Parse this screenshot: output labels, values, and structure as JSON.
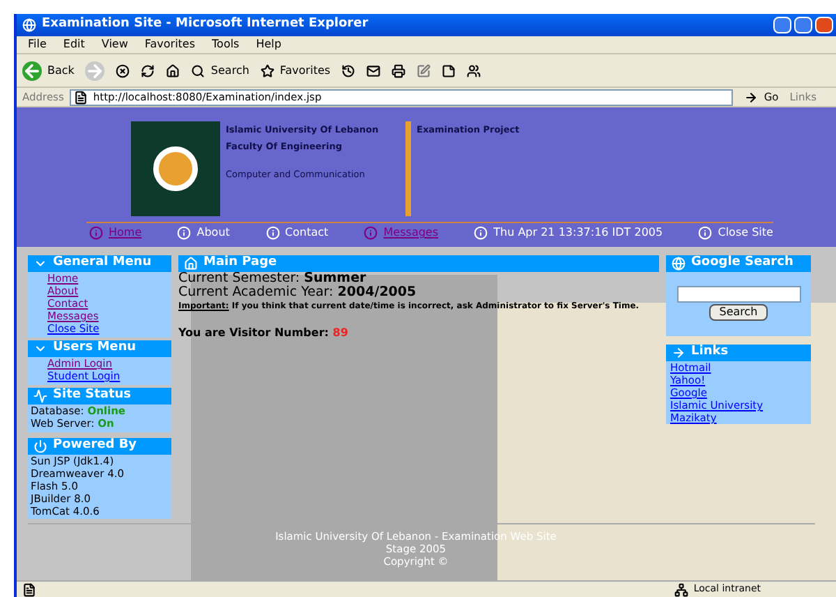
{
  "window": {
    "title": "Examination Site - Microsoft Internet Explorer"
  },
  "menu": [
    "File",
    "Edit",
    "View",
    "Favorites",
    "Tools",
    "Help"
  ],
  "toolbar": {
    "back": "Back",
    "search": "Search",
    "favorites": "Favorites"
  },
  "address": {
    "label": "Address",
    "value": "http://localhost:8080/Examination/index.jsp",
    "go": "Go",
    "links": "Links"
  },
  "header": {
    "university": "Islamic University Of Lebanon",
    "project": "Examination Project",
    "faculty": "Faculty Of Engineering",
    "department": "Computer and Communication"
  },
  "nav": [
    {
      "label": "Home",
      "linked": true
    },
    {
      "label": "About",
      "linked": false
    },
    {
      "label": "Contact",
      "linked": false
    },
    {
      "label": "Messages",
      "linked": true
    },
    {
      "label": "Thu Apr 21 13:37:16 IDT 2005",
      "linked": false
    },
    {
      "label": "Close Site",
      "linked": false
    }
  ],
  "general_menu": {
    "title": "General Menu",
    "items": [
      {
        "label": "Home",
        "visited": true
      },
      {
        "label": "About",
        "visited": true
      },
      {
        "label": "Contact",
        "visited": true
      },
      {
        "label": "Messages",
        "visited": true
      },
      {
        "label": "Close Site",
        "visited": false
      }
    ]
  },
  "users_menu": {
    "title": "Users Menu",
    "items": [
      {
        "label": "Admin Login",
        "visited": true
      },
      {
        "label": "Student Login",
        "visited": false
      }
    ]
  },
  "site_status": {
    "title": "Site Status",
    "rows": [
      {
        "label": "Database:",
        "value": "Online"
      },
      {
        "label": "Web Server:",
        "value": "On"
      }
    ]
  },
  "powered_by": {
    "title": "Powered By",
    "items": [
      "Sun JSP (Jdk1.4)",
      "Dreamweaver 4.0",
      "Flash 5.0",
      "JBuilder 8.0",
      "TomCat 4.0.6"
    ]
  },
  "main": {
    "title": "Main Page",
    "semester_label": "Current Semester:",
    "semester": "Summer",
    "year_label": "Current Academic Year:",
    "year": "2004/2005",
    "notice": "**Important:** If you think that current date/time is incorrect, ask Administrator to fix Server's Time.",
    "visitor_label": "You are Visitor Number:",
    "visitor": "89"
  },
  "google": {
    "title": "Google Search",
    "button": "Search"
  },
  "links": {
    "title": "Links",
    "items": [
      "Hotmail",
      "Yahoo!",
      "Google",
      "Islamic University",
      "Mazikaty"
    ]
  },
  "footer": [
    "Islamic University Of Lebanon - Examination Web Site",
    "Stage 2005",
    "Copyright ©"
  ],
  "status_bar": {
    "zone": "Local intranet"
  }
}
